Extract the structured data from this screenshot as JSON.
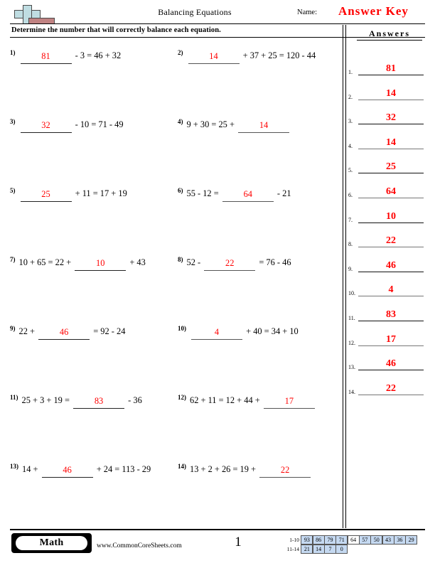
{
  "header": {
    "title": "Balancing Equations",
    "name_label": "Name:",
    "answer_key": "Answer Key",
    "logo_icon": "plus-block-logo",
    "logo_plus_color": "#bfdde2",
    "logo_bar_color": "#c08282"
  },
  "instructions": "Determine the number that will correctly balance each equation.",
  "answer_color": "#ff0000",
  "problems": [
    {
      "num": "1)",
      "pre": "",
      "answer": "81",
      "post": "- 3 = 46 + 32"
    },
    {
      "num": "2)",
      "pre": "",
      "answer": "14",
      "post": "+ 37 + 25 = 120 - 44"
    },
    {
      "num": "3)",
      "pre": "",
      "answer": "32",
      "post": "- 10 = 71 - 49"
    },
    {
      "num": "4)",
      "pre": "9 + 30 = 25 +",
      "answer": "14",
      "post": ""
    },
    {
      "num": "5)",
      "pre": "",
      "answer": "25",
      "post": "+ 11 = 17 + 19"
    },
    {
      "num": "6)",
      "pre": "55 - 12 =",
      "answer": "64",
      "post": "- 21"
    },
    {
      "num": "7)",
      "pre": "10 + 65 = 22 +",
      "answer": "10",
      "post": "+ 43"
    },
    {
      "num": "8)",
      "pre": "52 -",
      "answer": "22",
      "post": "= 76 - 46"
    },
    {
      "num": "9)",
      "pre": "22 +",
      "answer": "46",
      "post": "= 92 - 24"
    },
    {
      "num": "10)",
      "pre": "",
      "answer": "4",
      "post": "+ 40 = 34 + 10"
    },
    {
      "num": "11)",
      "pre": "25 + 3 + 19 =",
      "answer": "83",
      "post": "- 36"
    },
    {
      "num": "12)",
      "pre": "62 + 11 = 12 + 44 +",
      "answer": "17",
      "post": ""
    },
    {
      "num": "13)",
      "pre": "14 +",
      "answer": "46",
      "post": "+ 24 = 113 - 29"
    },
    {
      "num": "14)",
      "pre": "13 + 2 + 26 = 19 +",
      "answer": "22",
      "post": ""
    }
  ],
  "answers_panel": {
    "title": "Answers",
    "rows": [
      {
        "idx": "1.",
        "value": "81"
      },
      {
        "idx": "2.",
        "value": "14"
      },
      {
        "idx": "3.",
        "value": "32"
      },
      {
        "idx": "4.",
        "value": "14"
      },
      {
        "idx": "5.",
        "value": "25"
      },
      {
        "idx": "6.",
        "value": "64"
      },
      {
        "idx": "7.",
        "value": "10"
      },
      {
        "idx": "8.",
        "value": "22"
      },
      {
        "idx": "9.",
        "value": "46"
      },
      {
        "idx": "10.",
        "value": "4"
      },
      {
        "idx": "11.",
        "value": "83"
      },
      {
        "idx": "12.",
        "value": "17"
      },
      {
        "idx": "13.",
        "value": "46"
      },
      {
        "idx": "14.",
        "value": "22"
      }
    ]
  },
  "footer": {
    "subject_badge": "Math",
    "site_url": "www.CommonCoreSheets.com",
    "page_number": "1",
    "score_grid": {
      "shade_color": "#c5d9f1",
      "rows": [
        {
          "label": "1-10",
          "cells": [
            {
              "value": "93",
              "shaded": true
            },
            {
              "value": "86",
              "shaded": true
            },
            {
              "value": "79",
              "shaded": true
            },
            {
              "value": "71",
              "shaded": true
            },
            {
              "value": "64",
              "shaded": false
            },
            {
              "value": "57",
              "shaded": true
            },
            {
              "value": "50",
              "shaded": true
            },
            {
              "value": "43",
              "shaded": true
            },
            {
              "value": "36",
              "shaded": true
            },
            {
              "value": "29",
              "shaded": true
            }
          ]
        },
        {
          "label": "11-14",
          "cells": [
            {
              "value": "21",
              "shaded": true
            },
            {
              "value": "14",
              "shaded": true
            },
            {
              "value": "7",
              "shaded": true
            },
            {
              "value": "0",
              "shaded": true
            }
          ]
        }
      ]
    }
  }
}
